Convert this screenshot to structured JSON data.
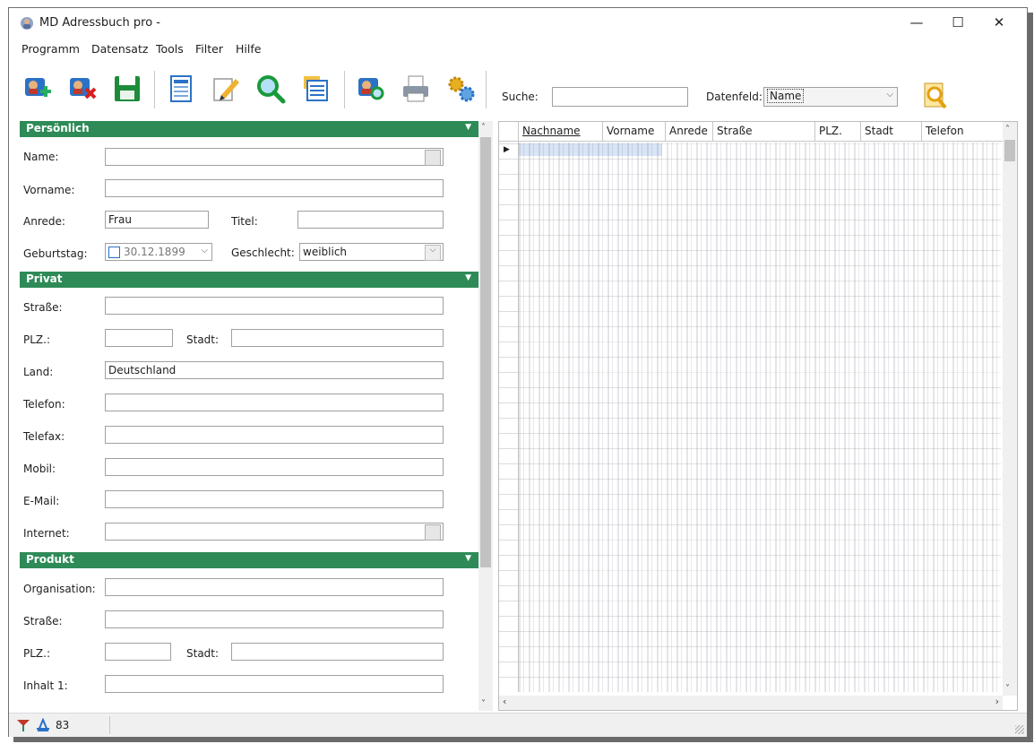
{
  "window": {
    "title": "MD Adressbuch pro -",
    "minimize": "—",
    "maximize": "☐",
    "close": "✕"
  },
  "menu": [
    "Programm",
    "Datensatz",
    "Tools",
    "Filter",
    "Hilfe"
  ],
  "toolbar": {
    "search_label": "Suche:",
    "search_value": "",
    "field_label": "Datenfeld:",
    "field_value": "Name"
  },
  "sections": {
    "personal": "Persönlich",
    "private": "Privat",
    "product": "Produkt"
  },
  "personal": {
    "name_label": "Name:",
    "name_value": "",
    "vorname_label": "Vorname:",
    "vorname_value": "",
    "anrede_label": "Anrede:",
    "anrede_value": "Frau",
    "titel_label": "Titel:",
    "titel_value": "",
    "geburtstag_label": "Geburtstag:",
    "geburtstag_value": "30.12.1899",
    "geschlecht_label": "Geschlecht:",
    "geschlecht_value": "weiblich"
  },
  "private": {
    "strasse_label": "Straße:",
    "strasse_value": "",
    "plz_label": "PLZ.:",
    "plz_value": "",
    "stadt_label": "Stadt:",
    "stadt_value": "",
    "land_label": "Land:",
    "land_value": "Deutschland",
    "telefon_label": "Telefon:",
    "telefax_label": "Telefax:",
    "mobil_label": "Mobil:",
    "email_label": "E-Mail:",
    "email_value": "",
    "internet_label": "Internet:"
  },
  "product": {
    "organisation_label": "Organisation:",
    "strasse_label": "Straße:",
    "plz_label": "PLZ.:",
    "stadt_label": "Stadt:",
    "inhalt1_label": "Inhalt 1:"
  },
  "grid": {
    "columns": [
      "Nachname",
      "Vorname",
      "Anrede",
      "Straße",
      "PLZ.",
      "Stadt",
      "Telefon"
    ]
  },
  "status": {
    "count": "83"
  },
  "colors": {
    "section_green": "#2e8b57",
    "accent_blue": "#2a6fc9"
  },
  "icons": [
    "add-record-icon",
    "delete-record-icon",
    "save-icon",
    "list-view-icon",
    "edit-icon",
    "search-icon",
    "copy-icon",
    "contacts-search-icon",
    "print-icon",
    "settings-icon",
    "find-icon"
  ]
}
